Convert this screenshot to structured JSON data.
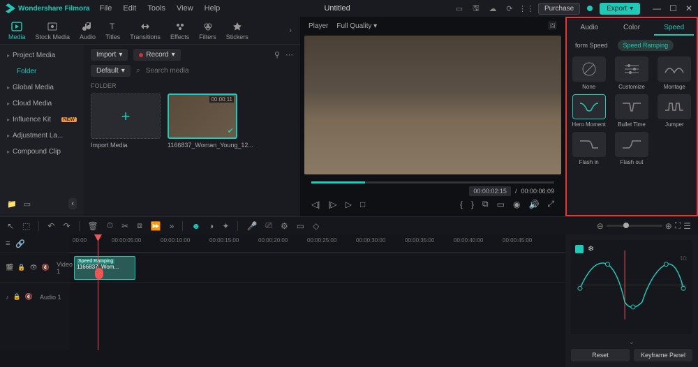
{
  "app": {
    "name": "Wondershare Filmora",
    "title": "Untitled"
  },
  "menu": [
    "File",
    "Edit",
    "Tools",
    "View",
    "Help"
  ],
  "titlebar": {
    "purchase": "Purchase",
    "export": "Export"
  },
  "tabs": [
    {
      "label": "Media",
      "active": true
    },
    {
      "label": "Stock Media"
    },
    {
      "label": "Audio"
    },
    {
      "label": "Titles"
    },
    {
      "label": "Transitions"
    },
    {
      "label": "Effects"
    },
    {
      "label": "Filters"
    },
    {
      "label": "Stickers"
    }
  ],
  "sidebar": {
    "items": [
      {
        "label": "Project Media"
      },
      {
        "label": "Folder",
        "folder": true
      },
      {
        "label": "Global Media"
      },
      {
        "label": "Cloud Media"
      },
      {
        "label": "Influence Kit",
        "badge": "NEW"
      },
      {
        "label": "Adjustment La..."
      },
      {
        "label": "Compound Clip"
      }
    ]
  },
  "browser": {
    "import": "Import",
    "record": "Record",
    "default": "Default",
    "searchPlaceholder": "Search media",
    "folderLabel": "FOLDER",
    "thumbs": [
      {
        "label": "Import Media",
        "import": true
      },
      {
        "label": "1166837_Woman_Young_12...",
        "dur": "00:00:11",
        "selected": true
      }
    ]
  },
  "player": {
    "label": "Player",
    "quality": "Full Quality",
    "current": "00:00:02:15",
    "total": "00:00:06:09",
    "sep": "/"
  },
  "right": {
    "tabs": [
      "Audio",
      "Color",
      "Speed"
    ],
    "activeTab": 2,
    "sub": [
      "form Speed",
      "Speed Ramping"
    ],
    "activeSub": 1,
    "presets": [
      {
        "label": "None"
      },
      {
        "label": "Customize"
      },
      {
        "label": "Montage"
      },
      {
        "label": "Hero Moment",
        "selected": true
      },
      {
        "label": "Bullet Time"
      },
      {
        "label": "Jumper"
      },
      {
        "label": "Flash in"
      },
      {
        "label": "Flash out"
      }
    ]
  },
  "timeline": {
    "ticks": [
      "00:00",
      "00:00:05:00",
      "00:00:10:00",
      "00:00:15:00",
      "00:00:20:00",
      "00:00:25:00",
      "00:00:30:00",
      "00:00:35:00",
      "00:00:40:00",
      "00:00:45:00"
    ],
    "tracks": [
      {
        "name": "Video 1",
        "type": "video"
      },
      {
        "name": "Audio 1",
        "type": "audio"
      }
    ],
    "clip": {
      "badge": "Speed Ramping",
      "name": "1166837_Wom..."
    }
  },
  "keyframe": {
    "reset": "Reset",
    "panel": "Keyframe Panel"
  }
}
